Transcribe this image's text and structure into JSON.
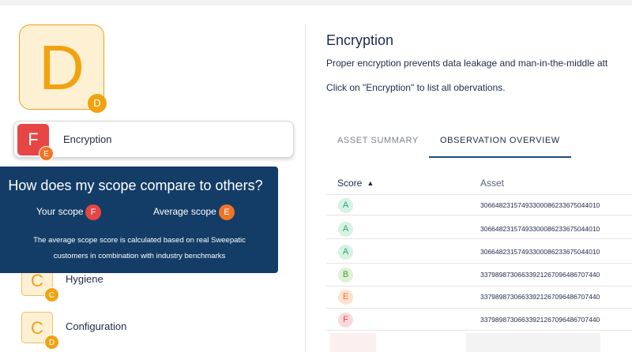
{
  "overall_grade": {
    "letter": "D",
    "badge": "D"
  },
  "categories": [
    {
      "label": "Encryption",
      "grade": "F",
      "badge": "E"
    },
    {
      "label": "Hygiene",
      "grade": "C",
      "badge": "C"
    },
    {
      "label": "Configuration",
      "grade": "C",
      "badge": "D"
    }
  ],
  "popover": {
    "title": "How does my scope compare to others?",
    "your_scope_label": "Your scope",
    "your_scope_grade": "F",
    "average_scope_label": "Average scope",
    "average_scope_grade": "E",
    "description_line1": "The average scope score is calculated based on real Sweepatic",
    "description_line2": "customers in combination with industry benchmarks"
  },
  "detail": {
    "title": "Encryption",
    "description": "Proper encryption prevents data leakage and man-in-the-middle att",
    "hint": "Click on \"Encryption\" to list all obervations."
  },
  "tabs": [
    {
      "label": "ASSET SUMMARY",
      "active": false
    },
    {
      "label": "OBSERVATION OVERVIEW",
      "active": true
    }
  ],
  "table": {
    "headers": {
      "score": "Score",
      "asset": "Asset"
    },
    "sort_icon": "▲",
    "rows": [
      {
        "score": "A",
        "asset": "30664823157493300086233675044010"
      },
      {
        "score": "A",
        "asset": "30664823157493300086233675044010"
      },
      {
        "score": "A",
        "asset": "30664823157493300086233675044010"
      },
      {
        "score": "B",
        "asset": "33798987306633921267096486707440"
      },
      {
        "score": "E",
        "asset": "33798987306633921267096486707440"
      },
      {
        "score": "F",
        "asset": "33798987306633921267096486707440"
      }
    ]
  },
  "colors": {
    "grade_a": "#2aa66a",
    "grade_b": "#4aa33e",
    "grade_c": "#e9a21b",
    "grade_d": "#f0a312",
    "grade_e": "#f07426",
    "grade_f": "#e84545",
    "popover_bg": "#133d66"
  }
}
